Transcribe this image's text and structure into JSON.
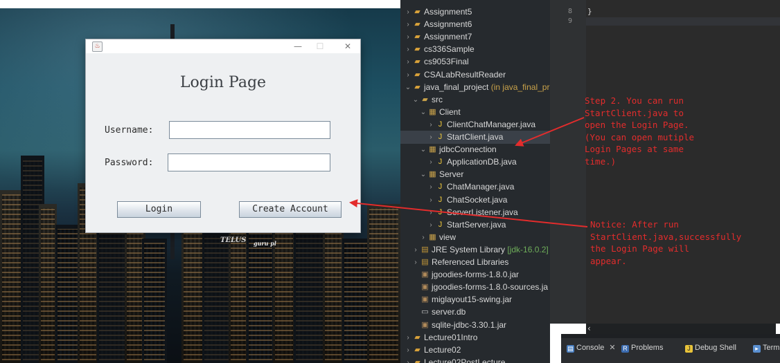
{
  "login_window": {
    "title": "Login Page",
    "username_label": "Username:",
    "password_label": "Password:",
    "username_value": "",
    "password_value": "",
    "login_button": "Login",
    "create_account_button": "Create Account",
    "minimize_glyph": "—",
    "maximize_glyph": "☐",
    "close_glyph": "✕"
  },
  "city_signs": {
    "sign_1": "TELUS",
    "sign_2": "guru pl"
  },
  "explorer": {
    "items": [
      {
        "label": "Assignment5",
        "expanded": false,
        "icon": "project-icon"
      },
      {
        "label": "Assignment6",
        "expanded": false,
        "icon": "project-icon"
      },
      {
        "label": "Assignment7",
        "expanded": false,
        "icon": "project-icon"
      },
      {
        "label": "cs336Sample",
        "expanded": false,
        "icon": "project-icon"
      },
      {
        "label": "cs9053Final",
        "expanded": false,
        "icon": "project-icon"
      },
      {
        "label": "CSALabResultReader",
        "expanded": false,
        "icon": "project-icon"
      },
      {
        "label": "java_final_project",
        "decoration": "(in java_final_pro",
        "expanded": true,
        "icon": "project-icon"
      },
      {
        "label": "src",
        "expanded": true,
        "icon": "source-folder-icon"
      },
      {
        "label": "Client",
        "expanded": true,
        "icon": "package-icon"
      },
      {
        "label": "ClientChatManager.java",
        "expanded": false,
        "icon": "java-file-icon"
      },
      {
        "label": "StartClient.java",
        "expanded": false,
        "icon": "java-file-icon",
        "selected": true
      },
      {
        "label": "jdbcConnection",
        "expanded": true,
        "icon": "package-icon"
      },
      {
        "label": "ApplicationDB.java",
        "expanded": false,
        "icon": "java-file-icon"
      },
      {
        "label": "Server",
        "expanded": true,
        "icon": "package-icon"
      },
      {
        "label": "ChatManager.java",
        "expanded": false,
        "icon": "java-file-icon"
      },
      {
        "label": "ChatSocket.java",
        "expanded": false,
        "icon": "java-file-icon"
      },
      {
        "label": "ServerListener.java",
        "expanded": false,
        "icon": "java-file-icon"
      },
      {
        "label": "StartServer.java",
        "expanded": false,
        "icon": "java-file-icon"
      },
      {
        "label": "view",
        "expanded": false,
        "icon": "package-icon"
      },
      {
        "label": "JRE System Library",
        "decoration": "[jdk-16.0.2]",
        "expanded": false,
        "icon": "library-icon"
      },
      {
        "label": "Referenced Libraries",
        "expanded": false,
        "icon": "library-icon"
      },
      {
        "label": "jgoodies-forms-1.8.0.jar",
        "icon": "jar-icon"
      },
      {
        "label": "jgoodies-forms-1.8.0-sources.ja",
        "icon": "jar-icon"
      },
      {
        "label": "miglayout15-swing.jar",
        "icon": "jar-icon"
      },
      {
        "label": "server.db",
        "icon": "file-icon"
      },
      {
        "label": "sqlite-jdbc-3.30.1.jar",
        "icon": "jar-icon"
      },
      {
        "label": "Lecture01Intro",
        "expanded": false,
        "icon": "project-icon"
      },
      {
        "label": "Lecture02",
        "expanded": false,
        "icon": "project-icon"
      },
      {
        "label": "Lecture02PostLecture",
        "expanded": false,
        "icon": "project-icon"
      }
    ]
  },
  "editor": {
    "line_numbers": [
      "8",
      "9"
    ],
    "lines": [
      "}",
      ""
    ]
  },
  "bottom_tabs": {
    "console": "Console",
    "console_close": "✕",
    "problems": "Problems",
    "debug_shell": "Debug Shell",
    "terminal": "Termi"
  },
  "annotations": {
    "step2": "Step 2. You can run\nStartClient.java to\nopen the Login Page.\n(You can open mutiple\nLogin Pages at same\ntime.)",
    "notice": "Notice: After run\nStartClient.java,successfully\nthe Login Page will\nappear."
  },
  "colors": {
    "annotation_red": "#e32c2c",
    "explorer_bg": "#262a2e",
    "editor_bg": "#2b2b2b"
  }
}
